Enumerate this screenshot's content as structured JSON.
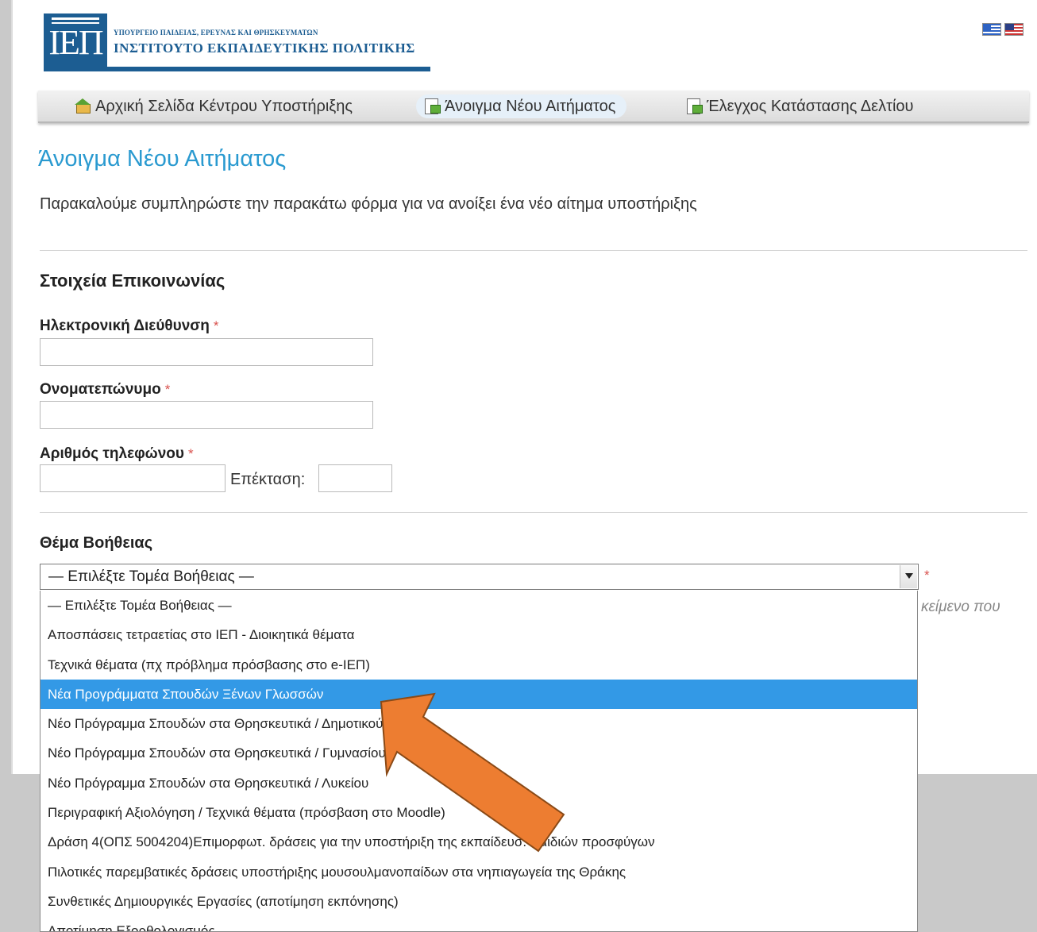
{
  "header": {
    "logo_mark": "ΙΕΠ",
    "ministry": "ΥΠΟΥΡΓΕΙΟ ΠΑΙΔΕΙΑΣ, ΕΡΕΥΝΑΣ ΚΑΙ ΘΡΗΣΚΕΥΜΑΤΩΝ",
    "institute": "ΙΝΣΤΙΤΟΥΤΟ ΕΚΠΑΙΔΕΥΤΙΚΗΣ ΠΟΛΙΤΙΚΗΣ",
    "languages": [
      "greek-flag-icon",
      "us-flag-icon"
    ]
  },
  "nav": {
    "items": [
      {
        "label": "Αρχική Σελίδα Κέντρου Υποστήριξης",
        "icon": "home-icon",
        "active": false
      },
      {
        "label": "Άνοιγμα Νέου Αιτήματος",
        "icon": "new-ticket-icon",
        "active": true
      },
      {
        "label": "Έλεγχος Κατάστασης Δελτίου",
        "icon": "ticket-status-icon",
        "active": false
      }
    ]
  },
  "main": {
    "heading": "Άνοιγμα Νέου Αιτήματος",
    "intro": "Παρακαλούμε συμπληρώστε την παρακάτω φόρμα για να ανοίξει ένα νέο αίτημα υποστήριξης"
  },
  "contact": {
    "title": "Στοιχεία Επικοινωνίας",
    "required_mark": "*",
    "email_label": "Ηλεκτρονική Διεύθυνση",
    "email_value": "",
    "name_label": "Ονοματεπώνυμο",
    "name_value": "",
    "phone_label": "Αριθμός τηλεφώνου",
    "phone_value": "",
    "ext_label": "Επέκταση:",
    "ext_value": ""
  },
  "topic": {
    "title": "Θέμα Βοήθειας",
    "selected": "— Επιλέξτε Τομέα Βοήθειας —",
    "hint": "κείμενο που",
    "options": [
      "— Επιλέξτε Τομέα Βοήθειας —",
      "Αποσπάσεις τετραετίας στο ΙΕΠ - Διοικητικά θέματα",
      "Τεχνικά θέματα (πχ πρόβλημα πρόσβασης στο e-ΙΕΠ)",
      "Νέα Προγράμματα Σπουδών Ξένων Γλωσσών",
      "Νέο Πρόγραμμα Σπουδών στα Θρησκευτικά / Δημοτικού",
      "Νέο Πρόγραμμα Σπουδών στα Θρησκευτικά / Γυμνασίου",
      "Νέο Πρόγραμμα Σπουδών στα Θρησκευτικά / Λυκείου",
      "Περιγραφική Αξιολόγηση / Τεχνικά θέματα (πρόσβαση στο Moodle)",
      "Δράση 4(ΟΠΣ 5004204)Επιμορφωτ. δράσεις για την υποστήριξη της εκπαίδευσ. παιδιών προσφύγων",
      "Πιλοτικές παρεμβατικές δράσεις υποστήριξης μουσουλμανοπαίδων στα νηπιαγωγεία της Θράκης",
      "Συνθετικές Δημιουργικές Εργασίες (αποτίμηση εκπόνησης)",
      "Αποτίμηση Εξορθολογισμός"
    ],
    "highlighted_index": 3
  },
  "annotation": {
    "arrow_color": "#ed7d31",
    "arrow_icon": "pointer-arrow-icon"
  },
  "colors": {
    "brand": "#1c5d92",
    "heading": "#2a9ad0",
    "highlight": "#3399e6",
    "required": "#d9534f"
  }
}
